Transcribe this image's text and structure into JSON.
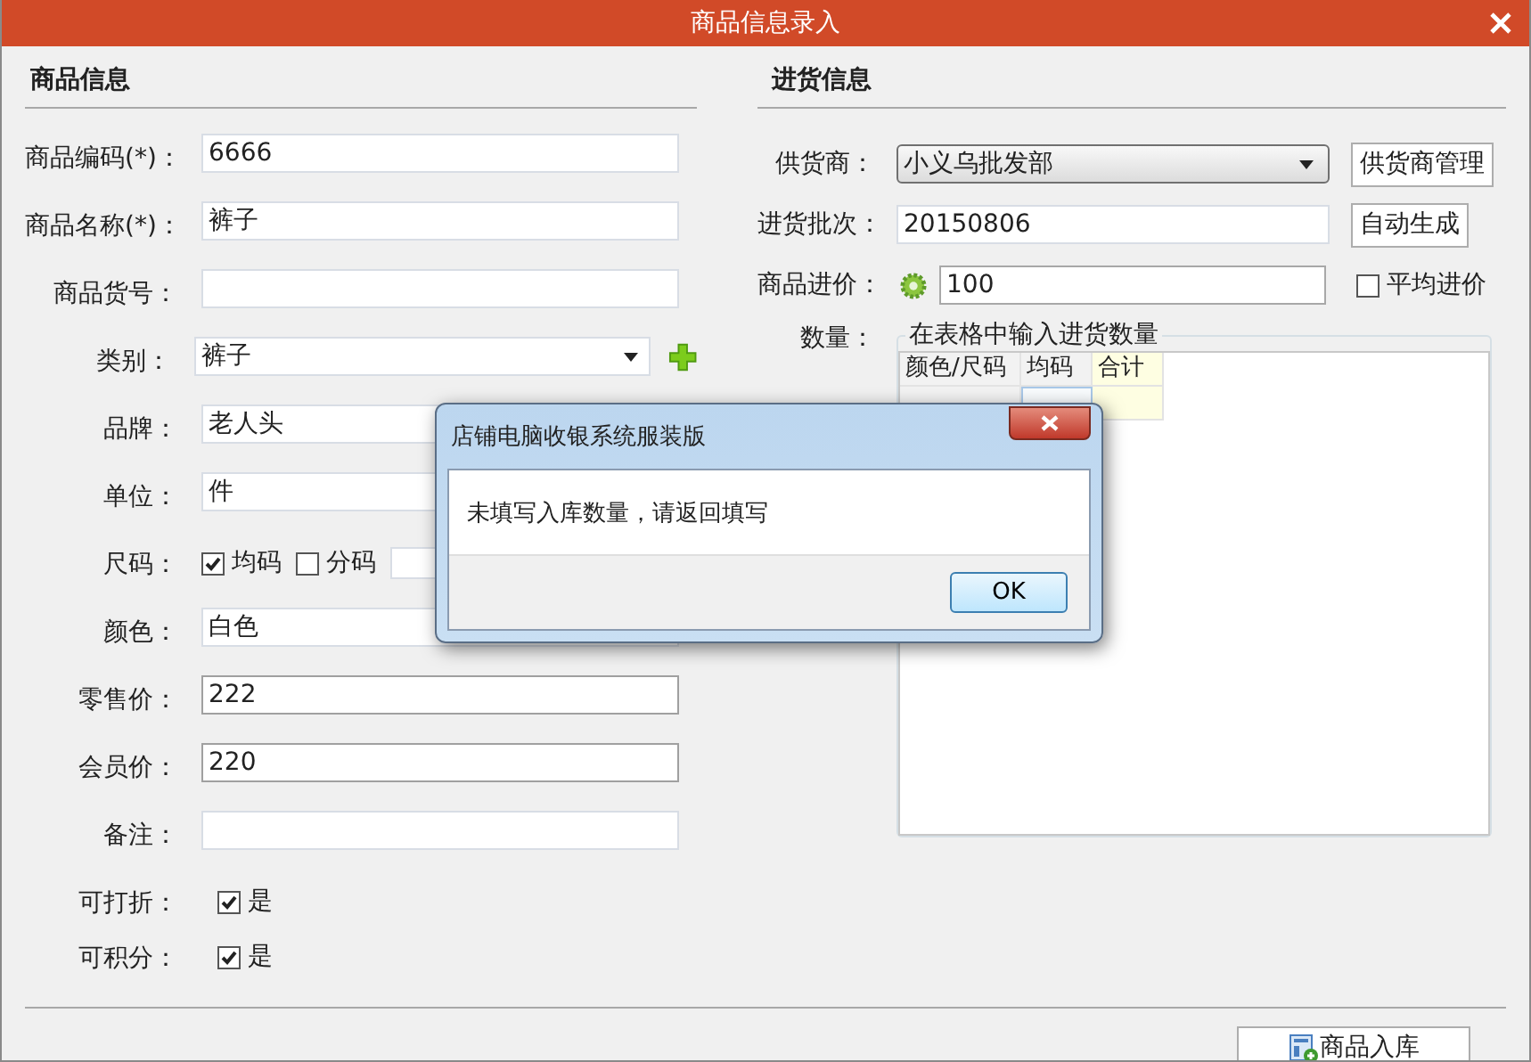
{
  "window": {
    "title": "商品信息录入"
  },
  "product": {
    "heading": "商品信息",
    "fields": [
      {
        "kind": "text",
        "label": "商品编码(*)：",
        "value": "6666"
      },
      {
        "kind": "text",
        "label": "商品名称(*)：",
        "value": "裤子"
      },
      {
        "kind": "text",
        "label": "商品货号："
      },
      {
        "kind": "select",
        "label": "类别：",
        "value": "裤子"
      },
      {
        "kind": "text",
        "label": "品牌：",
        "value": "老人头"
      },
      {
        "kind": "text",
        "label": "单位：",
        "value": "件"
      },
      {
        "kind": "sizes",
        "label": "尺码：",
        "options": [
          {
            "label": "均码",
            "checked": true
          },
          {
            "label": "分码",
            "checked": false
          }
        ]
      },
      {
        "kind": "text",
        "label": "颜色：",
        "value": "白色"
      },
      {
        "kind": "text",
        "label": "零售价：",
        "value": "222",
        "emphasis": true
      },
      {
        "kind": "text",
        "label": "会员价：",
        "value": "220",
        "emphasis": true
      },
      {
        "kind": "text",
        "label": "备注："
      },
      {
        "kind": "check",
        "label": "可打折：",
        "option": "是",
        "checked": true
      },
      {
        "kind": "check",
        "label": "可积分：",
        "option": "是",
        "checked": true
      }
    ]
  },
  "purchase": {
    "heading": "进货信息",
    "supplier": {
      "label": "供货商：",
      "value": "小义乌批发部",
      "button": "供货商管理"
    },
    "batch": {
      "label": "进货批次：",
      "value": "20150806",
      "button": "自动生成"
    },
    "cost": {
      "label": "商品进价：",
      "value": "100",
      "average_label": "平均进价",
      "average_checked": false
    },
    "quantity": {
      "label": "数量：",
      "legend": "在表格中输入进货数量",
      "columns": [
        "颜色/尺码",
        "均码",
        "合计"
      ]
    }
  },
  "footer": {
    "button": "商品入库"
  },
  "dialog": {
    "title": "店铺电脑收银系统服装版",
    "message": "未填写入库数量，请返回填写",
    "button": "OK"
  }
}
